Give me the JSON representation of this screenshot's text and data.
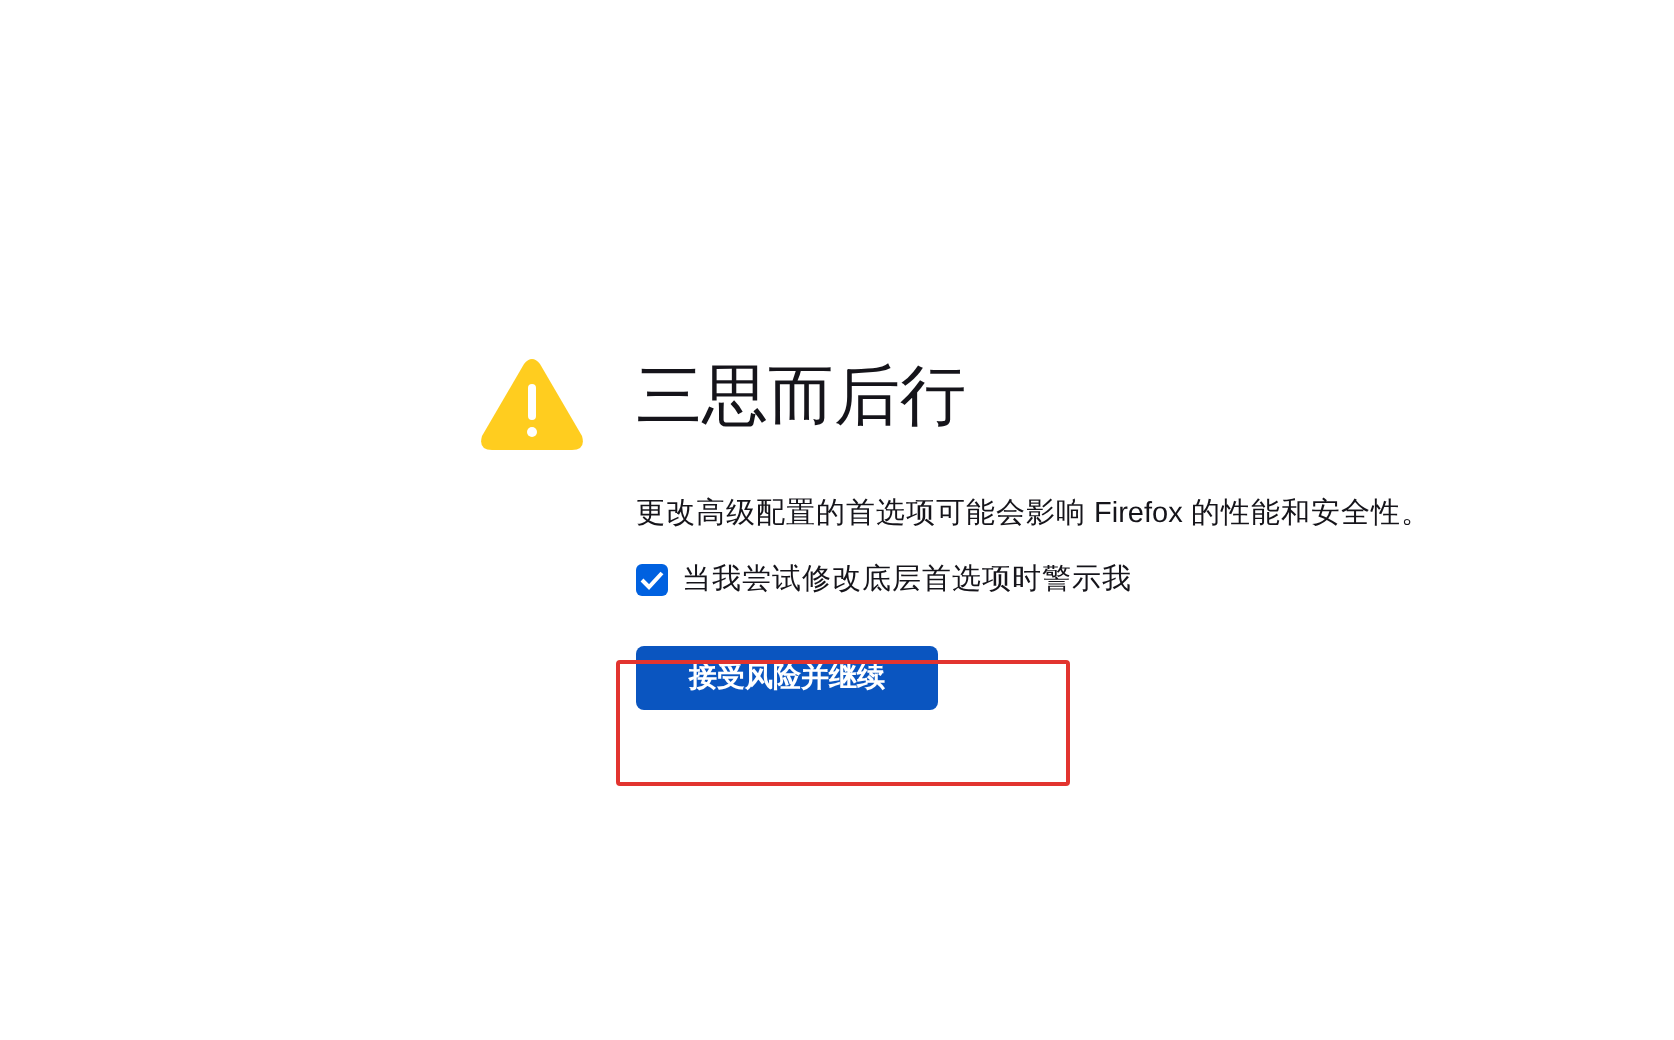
{
  "title": "三思而后行",
  "description": "更改高级配置的首选项可能会影响 Firefox 的性能和安全性。",
  "checkbox": {
    "label": "当我尝试修改底层首选项时警示我",
    "checked": true
  },
  "button": {
    "label": "接受风险并继续"
  }
}
